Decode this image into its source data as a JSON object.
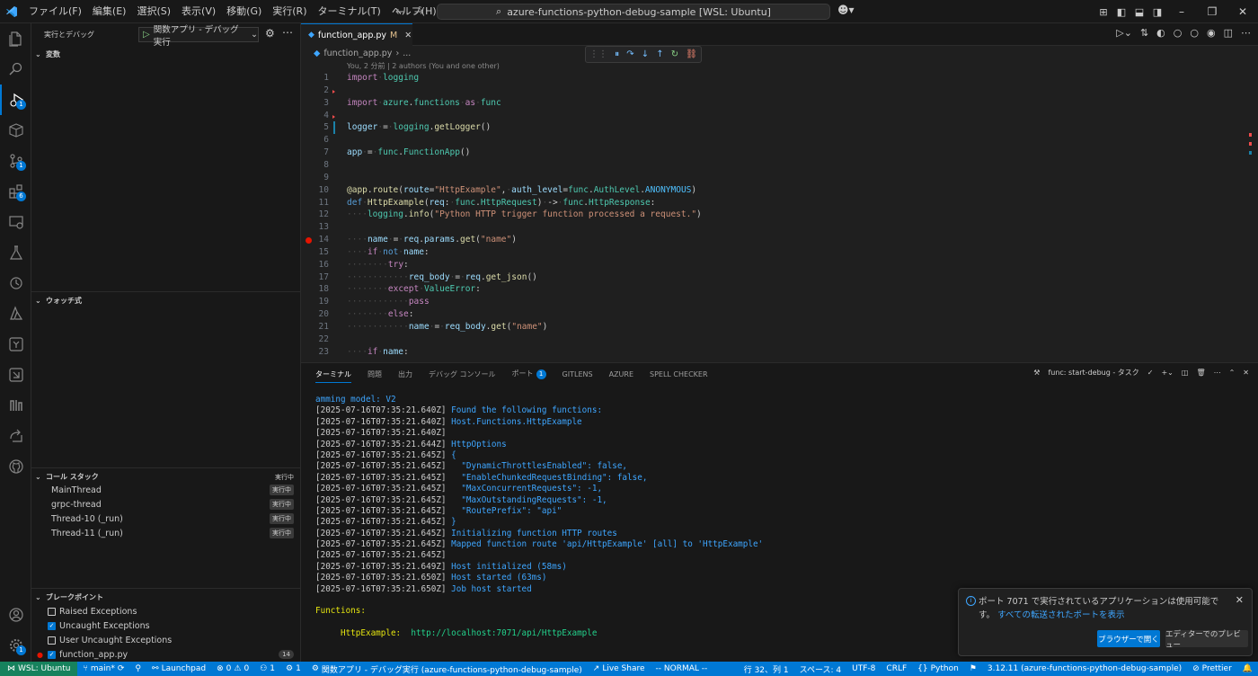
{
  "titlebar": {
    "menus": [
      "ファイル(F)",
      "編集(E)",
      "選択(S)",
      "表示(V)",
      "移動(G)",
      "実行(R)",
      "ターミナル(T)",
      "ヘルプ(H)"
    ],
    "search": "azure-functions-python-debug-sample [WSL: Ubuntu]"
  },
  "activity": {
    "debug_badge": "1",
    "scm_badge": "1",
    "ext_badge": "6",
    "manage_badge": "1"
  },
  "sidebar": {
    "title": "実行とデバッグ",
    "config": "関数アプリ - デバッグ実行",
    "variables": "変数",
    "watch": "ウォッチ式",
    "callstack": "コール スタック",
    "callstack_status": "実行中",
    "threads": [
      {
        "name": "MainThread",
        "tag": "実行中"
      },
      {
        "name": "grpc-thread",
        "tag": "実行中"
      },
      {
        "name": "Thread-10 (_run)",
        "tag": "実行中"
      },
      {
        "name": "Thread-11 (_run)",
        "tag": "実行中"
      }
    ],
    "breakpoints": "ブレークポイント",
    "bp_items": [
      {
        "label": "Raised Exceptions",
        "checked": false
      },
      {
        "label": "Uncaught Exceptions",
        "checked": true
      },
      {
        "label": "User Uncaught Exceptions",
        "checked": false
      }
    ],
    "bp_file": "function_app.py",
    "bp_file_count": "14"
  },
  "editor": {
    "tab_label": "function_app.py",
    "tab_modified": "M",
    "breadcrumb_file": "function_app.py",
    "breadcrumb_more": "...",
    "blame": "You, 2 分前 | 2 authors (You and one other)",
    "line_numbers": [
      "1",
      "2",
      "3",
      "4",
      "5",
      "6",
      "7",
      "8",
      "9",
      "10",
      "11",
      "12",
      "13",
      "14",
      "15",
      "16",
      "17",
      "18",
      "19",
      "20",
      "21",
      "22",
      "23"
    ]
  },
  "panel": {
    "tabs": [
      "ターミナル",
      "問題",
      "出力",
      "デバッグ コンソール",
      "ポート",
      "GITLENS",
      "AZURE",
      "SPELL CHECKER"
    ],
    "ports_badge": "1",
    "task": "func: start-debug - タスク",
    "terminal": [
      {
        "ts": "",
        "text": "amming model: V2",
        "cls": "tc"
      },
      {
        "ts": "[2025-07-16T07:35:21.640Z]",
        "text": " Found the following functions:",
        "cls": "tc"
      },
      {
        "ts": "[2025-07-16T07:35:21.640Z]",
        "text": " Host.Functions.HttpExample",
        "cls": "tc"
      },
      {
        "ts": "[2025-07-16T07:35:21.640Z]",
        "text": "",
        "cls": "tc"
      },
      {
        "ts": "[2025-07-16T07:35:21.644Z]",
        "text": " HttpOptions",
        "cls": "tc"
      },
      {
        "ts": "[2025-07-16T07:35:21.645Z]",
        "text": " {",
        "cls": "tc"
      },
      {
        "ts": "[2025-07-16T07:35:21.645Z]",
        "text": "   \"DynamicThrottlesEnabled\": false,",
        "cls": "tc"
      },
      {
        "ts": "[2025-07-16T07:35:21.645Z]",
        "text": "   \"EnableChunkedRequestBinding\": false,",
        "cls": "tc"
      },
      {
        "ts": "[2025-07-16T07:35:21.645Z]",
        "text": "   \"MaxConcurrentRequests\": -1,",
        "cls": "tc"
      },
      {
        "ts": "[2025-07-16T07:35:21.645Z]",
        "text": "   \"MaxOutstandingRequests\": -1,",
        "cls": "tc"
      },
      {
        "ts": "[2025-07-16T07:35:21.645Z]",
        "text": "   \"RoutePrefix\": \"api\"",
        "cls": "tc"
      },
      {
        "ts": "[2025-07-16T07:35:21.645Z]",
        "text": " }",
        "cls": "tc"
      },
      {
        "ts": "[2025-07-16T07:35:21.645Z]",
        "text": " Initializing function HTTP routes",
        "cls": "tc"
      },
      {
        "ts": "[2025-07-16T07:35:21.645Z]",
        "text": " Mapped function route 'api/HttpExample' [all] to 'HttpExample'",
        "cls": "tc"
      },
      {
        "ts": "[2025-07-16T07:35:21.645Z]",
        "text": "",
        "cls": "tc"
      },
      {
        "ts": "[2025-07-16T07:35:21.649Z]",
        "text": " Host initialized (58ms)",
        "cls": "tc"
      },
      {
        "ts": "[2025-07-16T07:35:21.650Z]",
        "text": " Host started (63ms)",
        "cls": "tc"
      },
      {
        "ts": "[2025-07-16T07:35:21.650Z]",
        "text": " Job host started",
        "cls": "tc"
      }
    ],
    "functions_label": "Functions:",
    "fn_name": "HttpExample:",
    "fn_url": "http://localhost:7071/api/HttpExample"
  },
  "notification": {
    "message": "ポート 7071 で実行されているアプリケーションは使用可能です。",
    "link": "すべての転送されたポートを表示",
    "primary": "ブラウザーで開く",
    "secondary": "エディターでのプレビュー"
  },
  "statusbar": {
    "remote": "WSL: Ubuntu",
    "branch": "main*",
    "launchpad": "Launchpad",
    "errors": "0",
    "warnings": "0",
    "ports": "1",
    "debug": "1",
    "config": "関数アプリ - デバッグ実行 (azure-functions-python-debug-sample)",
    "liveshare": "Live Share",
    "mode": "-- NORMAL --",
    "position": "行 32、列 1",
    "spaces": "スペース: 4",
    "encoding": "UTF-8",
    "eol": "CRLF",
    "lang": "Python",
    "interpreter": "3.12.11 (azure-functions-python-debug-sample)",
    "prettier": "Prettier"
  }
}
